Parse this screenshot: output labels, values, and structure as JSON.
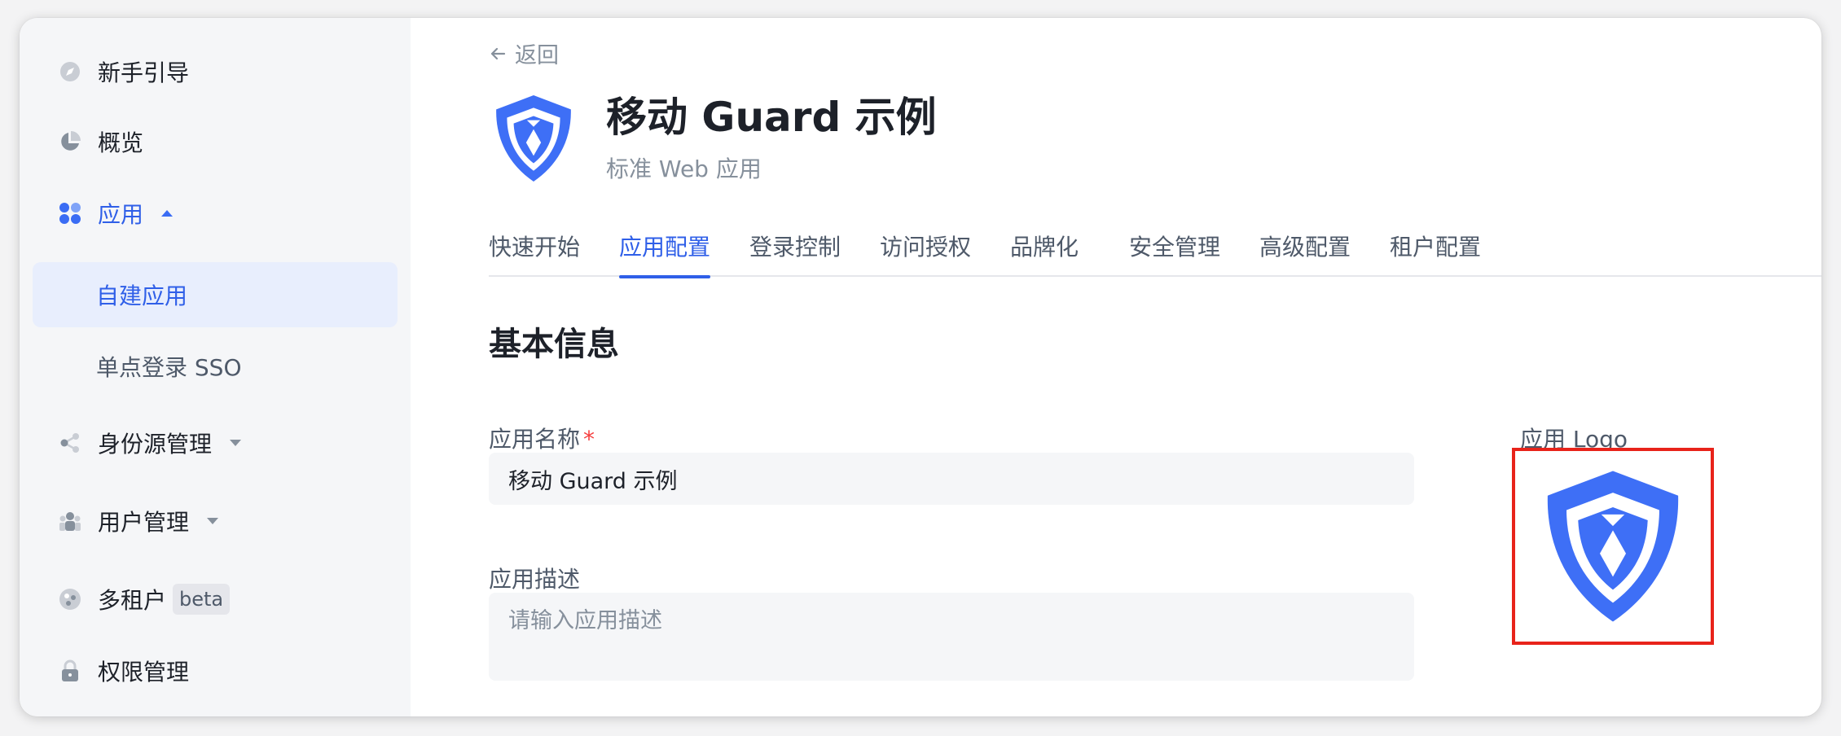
{
  "sidebar": {
    "items": [
      {
        "label": "新手引导",
        "icon": "compass-icon"
      },
      {
        "label": "概览",
        "icon": "pie-chart-icon"
      },
      {
        "label": "应用",
        "icon": "apps-icon",
        "expanded": true
      },
      {
        "label": "身份源管理",
        "icon": "share-icon"
      },
      {
        "label": "用户管理",
        "icon": "users-icon"
      },
      {
        "label": "多租户",
        "icon": "tenant-icon",
        "badge": "beta"
      },
      {
        "label": "权限管理",
        "icon": "lock-icon"
      }
    ],
    "subitems": [
      {
        "label": "自建应用",
        "active": true
      },
      {
        "label": "单点登录 SSO",
        "active": false
      }
    ]
  },
  "main": {
    "back_label": "返回",
    "app_title": "移动 Guard 示例",
    "app_subtitle": "标准 Web 应用",
    "tabs": [
      {
        "label": "快速开始"
      },
      {
        "label": "应用配置",
        "active": true
      },
      {
        "label": "登录控制"
      },
      {
        "label": "访问授权"
      },
      {
        "label": "品牌化"
      },
      {
        "label": "安全管理"
      },
      {
        "label": "高级配置"
      },
      {
        "label": "租户配置"
      }
    ],
    "section_title": "基本信息",
    "fields": {
      "app_name_label": "应用名称",
      "app_name_required": "*",
      "app_name_value": "移动 Guard 示例",
      "app_desc_label": "应用描述",
      "app_desc_placeholder": "请输入应用描述",
      "app_logo_label": "应用 Logo"
    }
  },
  "colors": {
    "accent": "#2f5fe8",
    "logo_blue": "#3e6ff6",
    "highlight_border": "#e8231a",
    "sidebar_bg": "#f5f6f8",
    "active_bg": "#e8eefd"
  }
}
